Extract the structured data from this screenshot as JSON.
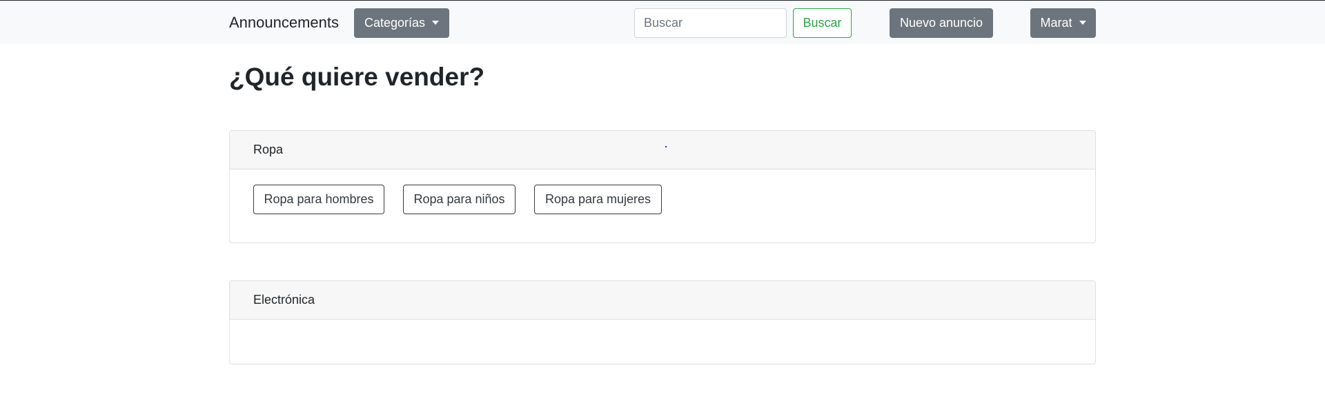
{
  "navbar": {
    "brand": "Announcements",
    "categories_label": "Categorías",
    "search_placeholder": "Buscar",
    "search_button": "Buscar",
    "new_ad_button": "Nuevo anuncio",
    "user_menu_label": "Marat"
  },
  "main": {
    "title": "¿Qué quiere vender?",
    "categories": [
      {
        "name": "Ropa",
        "subcategories": [
          "Ropa para hombres",
          "Ropa para niños",
          "Ropa para mujeres"
        ]
      },
      {
        "name": "Electrónica",
        "subcategories": []
      }
    ]
  },
  "colors": {
    "navbar_bg": "#f8f9fa",
    "secondary": "#6c757d",
    "success": "#28a745",
    "card_header_bg": "#f7f7f7"
  }
}
